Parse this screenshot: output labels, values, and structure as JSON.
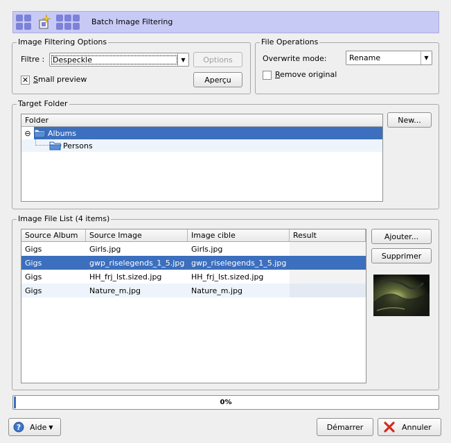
{
  "banner": {
    "title": "Batch Image Filtering"
  },
  "options": {
    "group_title": "Image Filtering Options",
    "filter_label": "Filtre :",
    "filter_value": "Despeckle",
    "options_button": "Options",
    "small_preview_label": "Small preview",
    "small_preview_checked": true,
    "preview_button": "Aperçu"
  },
  "file_ops": {
    "group_title": "File Operations",
    "overwrite_label": "Overwrite mode:",
    "overwrite_value": "Rename",
    "remove_original_label": "Remove original",
    "remove_original_checked": false
  },
  "target": {
    "group_title": "Target Folder",
    "column": "Folder",
    "new_button": "New...",
    "tree": [
      {
        "label": "Albums",
        "depth": 0,
        "expanded": true,
        "selected": true
      },
      {
        "label": "Persons",
        "depth": 1,
        "selected": false
      }
    ]
  },
  "file_list": {
    "group_title": "Image File List (4 items)",
    "columns": [
      "Source Album",
      "Source Image",
      "Image cible",
      "Result"
    ],
    "rows": [
      {
        "album": "Gigs",
        "source": "Girls.jpg",
        "target": "Girls.jpg",
        "result": ""
      },
      {
        "album": "Gigs",
        "source": "gwp_riselegends_1_5.jpg",
        "target": "gwp_riselegends_1_5.jpg",
        "result": "",
        "selected": true
      },
      {
        "album": "Gigs",
        "source": "HH_frj_lst.sized.jpg",
        "target": "HH_frj_lst.sized.jpg",
        "result": ""
      },
      {
        "album": "Gigs",
        "source": "Nature_m.jpg",
        "target": "Nature_m.jpg",
        "result": ""
      }
    ],
    "add_button": "Ajouter...",
    "remove_button": "Supprimer"
  },
  "progress": {
    "value": 0,
    "text": "0%"
  },
  "footer": {
    "help_button": "Aide",
    "start_button": "Démarrer",
    "cancel_button": "Annuler"
  },
  "colors": {
    "selection": "#3c6fbd",
    "banner": "#c8caf6"
  }
}
